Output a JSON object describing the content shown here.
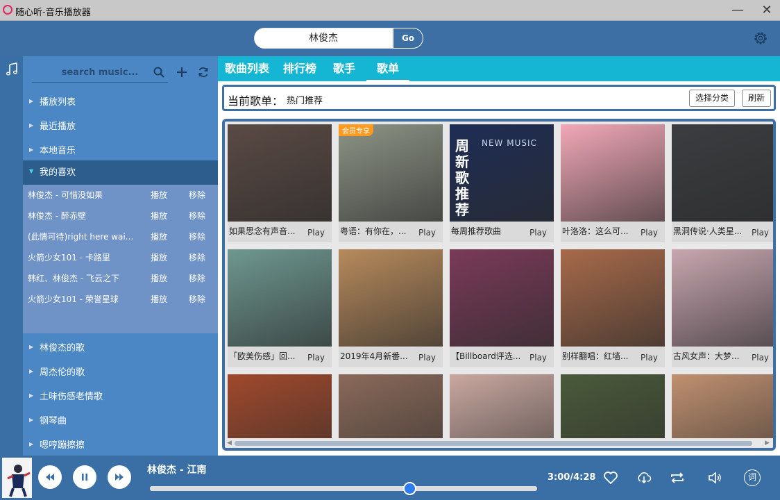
{
  "window": {
    "title": "随心听-音乐播放器",
    "minimize": "—",
    "close": "✕"
  },
  "top_search": {
    "value": "林俊杰",
    "go_label": "Go"
  },
  "sidebar": {
    "search_placeholder": "search music...",
    "items": [
      {
        "label": "播放列表"
      },
      {
        "label": "最近播放"
      },
      {
        "label": "本地音乐"
      },
      {
        "label": "我的喜欢",
        "expanded": true
      }
    ],
    "favorites": [
      {
        "name": "林俊杰 - 可惜没如果",
        "play": "播放",
        "remove": "移除"
      },
      {
        "name": "林俊杰 - 醉赤壁",
        "play": "播放",
        "remove": "移除"
      },
      {
        "name": "(此情可待)right here wai...",
        "play": "播放",
        "remove": "移除"
      },
      {
        "name": "火箭少女101 - 卡路里",
        "play": "播放",
        "remove": "移除"
      },
      {
        "name": "韩红、林俊杰 - 飞云之下",
        "play": "播放",
        "remove": "移除"
      },
      {
        "name": "火箭少女101 - 荣誉星球",
        "play": "播放",
        "remove": "移除"
      }
    ],
    "more_items": [
      {
        "label": "林俊杰的歌"
      },
      {
        "label": "周杰伦的歌"
      },
      {
        "label": "土味伤感老情歌"
      },
      {
        "label": "钢琴曲"
      },
      {
        "label": "嗯哼蹦擦擦"
      }
    ]
  },
  "tabs": [
    {
      "label": "歌曲列表"
    },
    {
      "label": "排行榜"
    },
    {
      "label": "歌手"
    },
    {
      "label": "歌单",
      "active": true
    }
  ],
  "current_playlist": {
    "label": "当前歌单：",
    "value": "热门推荐",
    "choose_category": "选择分类",
    "refresh": "刷新"
  },
  "playlists": [
    {
      "title": "如果思念有声音...",
      "play": "Play",
      "cover_color": "#5a4a44"
    },
    {
      "title": "粤语：有你在，...",
      "play": "Play",
      "cover_color": "#8d9486",
      "badge": "会员专享"
    },
    {
      "title": "每周推荐歌曲",
      "play": "Play",
      "cover_color": "#1e2d55",
      "cover_text": [
        "周",
        "新",
        "歌",
        "推",
        "荐"
      ],
      "cover_caption": "NEW MUSIC"
    },
    {
      "title": "叶洛洛：这么可...",
      "play": "Play",
      "cover_color": "#f2a8b8"
    },
    {
      "title": "黑洞传说·人类星...",
      "play": "Play",
      "cover_color": "#3b3d40"
    },
    {
      "title": "「欧美伤感」回...",
      "play": "Play",
      "cover_color": "#6e9890"
    },
    {
      "title": "2019年4月新番...",
      "play": "Play",
      "cover_color": "#b78a5c"
    },
    {
      "title": "【Billboard评选...",
      "play": "Play",
      "cover_color": "#7a3a58"
    },
    {
      "title": "别样翻唱：红墙...",
      "play": "Play",
      "cover_color": "#a86a4a"
    },
    {
      "title": "古风女声：大梦...",
      "play": "Play",
      "cover_color": "#c8a6b0"
    },
    {
      "title": "",
      "play": "",
      "cover_color": "#a0492c"
    },
    {
      "title": "",
      "play": "",
      "cover_color": "#8a6a5a"
    },
    {
      "title": "",
      "play": "",
      "cover_color": "#c9a8a0"
    },
    {
      "title": "",
      "play": "",
      "cover_color": "#4a5a3a"
    },
    {
      "title": "",
      "play": "",
      "cover_color": "#c09070"
    }
  ],
  "player": {
    "now_playing": "林俊杰 - 江南",
    "elapsed": "3:00",
    "total": "4:28",
    "time_display": "3:00/4:28",
    "progress": 0.67,
    "lyrics_icon_text": "词"
  },
  "colors": {
    "accent": "#14b6d4",
    "frame": "#3d6fa5",
    "sidebar": "#4a87c4",
    "knob": "#2d7cf2"
  },
  "icons": [
    "app-logo-icon",
    "minimize-icon",
    "close-icon",
    "settings-icon",
    "music-note-icon",
    "search-icon",
    "add-icon",
    "refresh-icon",
    "previous-icon",
    "pause-icon",
    "next-icon",
    "heart-icon",
    "download-icon",
    "repeat-icon",
    "volume-icon",
    "lyrics-icon"
  ]
}
